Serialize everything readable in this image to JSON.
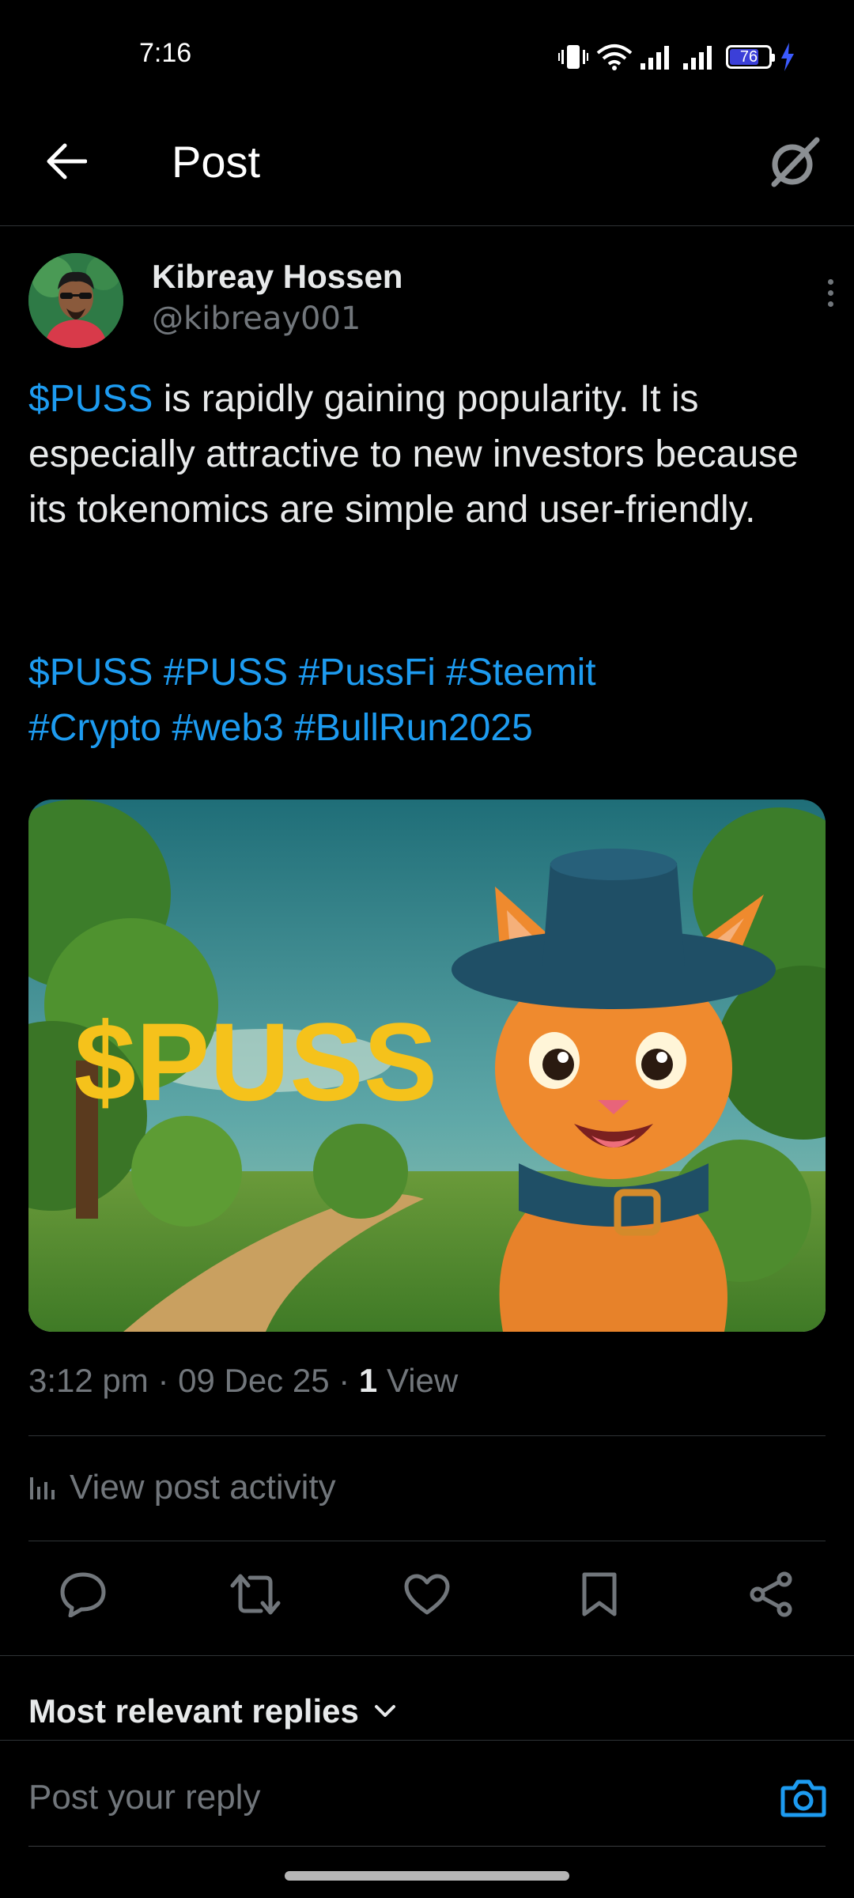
{
  "status_bar": {
    "time": "7:16",
    "battery_level": "76",
    "battery_fraction": 0.76,
    "icons": [
      "vibrate-icon",
      "wifi-icon",
      "signal-icon",
      "signal-icon",
      "battery-icon",
      "charging-icon"
    ]
  },
  "header": {
    "title": "Post",
    "back_icon": "arrow-left-icon",
    "grok_icon": "grok-icon"
  },
  "author": {
    "name": "Kibreay Hossen",
    "handle": "@kibreay001"
  },
  "post": {
    "cashtag": "$PUSS",
    "text_rest": " is rapidly gaining popularity. It is especially attractive to new investors because its tokenomics are simple and user-friendly.",
    "hashtags_line1": "$PUSS #PUSS #PussFi #Steemit",
    "hashtags_line2": "#Crypto #web3 #BullRun2025",
    "image_text": "$PUSS"
  },
  "meta": {
    "time": "3:12 pm",
    "date": "09 Dec 25",
    "separator": "·",
    "views_count": "1",
    "views_label": "View"
  },
  "activity": {
    "label": "View post activity"
  },
  "actions": {
    "reply": "reply-icon",
    "repost": "repost-icon",
    "like": "heart-icon",
    "bookmark": "bookmark-icon",
    "share": "share-icon"
  },
  "replies": {
    "sort_label": "Most relevant replies"
  },
  "reply_box": {
    "placeholder": "Post your reply"
  },
  "colors": {
    "background": "#000000",
    "accent": "#1d9bf0",
    "text": "#e7e9ea",
    "secondary": "#71767b",
    "divider": "#2f3336"
  }
}
